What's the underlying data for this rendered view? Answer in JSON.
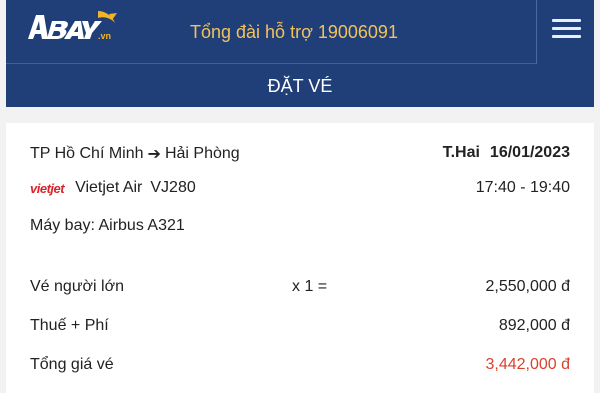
{
  "header": {
    "logo_text": "ABAY.vn",
    "hotline": "Tổng đài hỗ trợ 19006091",
    "menu_icon": "hamburger-menu-icon"
  },
  "page": {
    "title": "ĐẶT VÉ"
  },
  "booking": {
    "origin": "TP Hồ Chí Minh",
    "destination": "Hải Phòng",
    "route_arrow_icon": "arrow-right-icon",
    "day": "T.Hai",
    "date": "16/01/2023",
    "airline_logo": "vietjet",
    "airline_name": "Vietjet Air",
    "flight_number": "VJ280",
    "time": "17:40 - 19:40",
    "aircraft": "Máy bay: Airbus A321"
  },
  "fare": {
    "adult_label": "Vé người lớn",
    "adult_qty": "x 1 =",
    "adult_amount": "2,550,000 đ",
    "tax_label": "Thuế + Phí",
    "tax_amount": "892,000 đ",
    "total_label": "Tổng giá vé",
    "total_amount": "3,442,000 đ"
  },
  "colors": {
    "header_bg": "#203f79",
    "hotline_text": "#f2c25a",
    "total_price": "#d9412f",
    "airline_logo": "#d8242c"
  }
}
